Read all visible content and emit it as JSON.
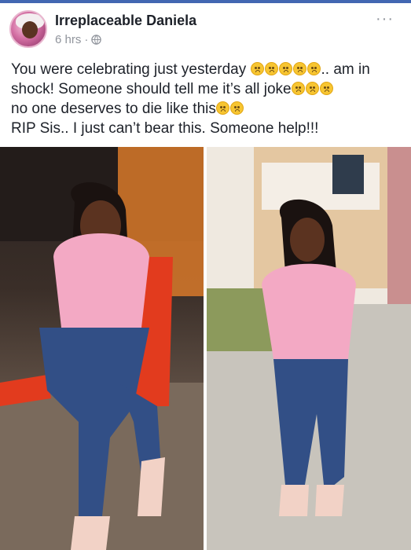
{
  "colors": {
    "brand": "#4267b2",
    "text": "#1d2129",
    "meta": "#90949c"
  },
  "post": {
    "author": "Irreplaceable Daniela",
    "time": "6 hrs",
    "separator": "·",
    "privacy_icon": "globe-icon",
    "more_icon": "more-options-icon",
    "more_glyph": "···",
    "text_line1_a": "You were celebrating just yesterday ",
    "text_line1_b": ".. am in shock! Someone should tell me it’s all joke",
    "text_line2": "no one deserves to die like this",
    "text_line3": "RIP Sis.. I just can’t bear this. Someone help!!!"
  }
}
